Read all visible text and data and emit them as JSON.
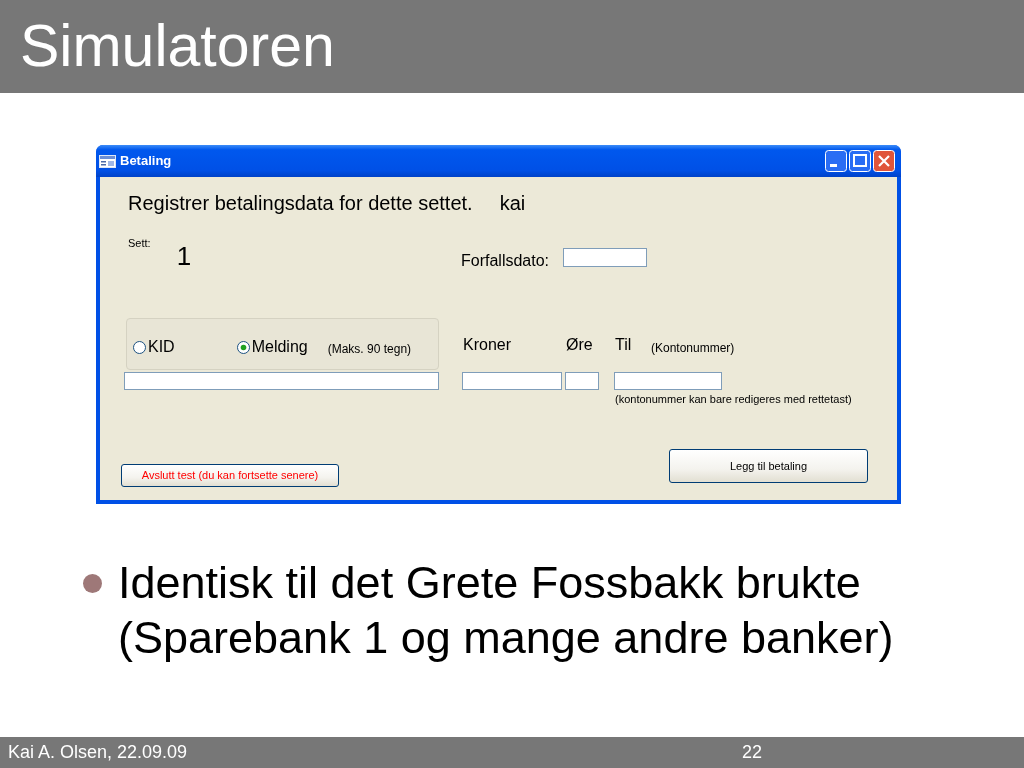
{
  "slide_title": "Simulatoren",
  "dialog": {
    "title": "Betaling",
    "heading": "Registrer betalingsdata for dette settet.",
    "user": "kai",
    "set": {
      "label": "Sett:",
      "value": "1"
    },
    "due_date": {
      "label": "Forfallsdato:"
    },
    "reference_options": [
      {
        "label": "KID",
        "selected": false
      },
      {
        "label": "Melding",
        "selected": true
      }
    ],
    "message_hint": "(Maks. 90 tegn)",
    "kroner": {
      "label": "Kroner"
    },
    "ore": {
      "label": "Øre"
    },
    "account": {
      "label": "Til",
      "hint": "(Kontonummer)",
      "note": "(kontonummer kan bare redigeres med rettetast)"
    },
    "buttons": [
      {
        "label": "Avslutt test (du kan fortsette senere)",
        "kind": "warning"
      },
      {
        "label": "Legg til betaling",
        "kind": "default"
      }
    ]
  },
  "bullets": [
    "Identisk til det Grete Fossbakk brukte (Sparebank 1 og mange andre banker)"
  ],
  "footer": {
    "left": "Kai A. Olsen, 22.09.09",
    "page": "22"
  }
}
